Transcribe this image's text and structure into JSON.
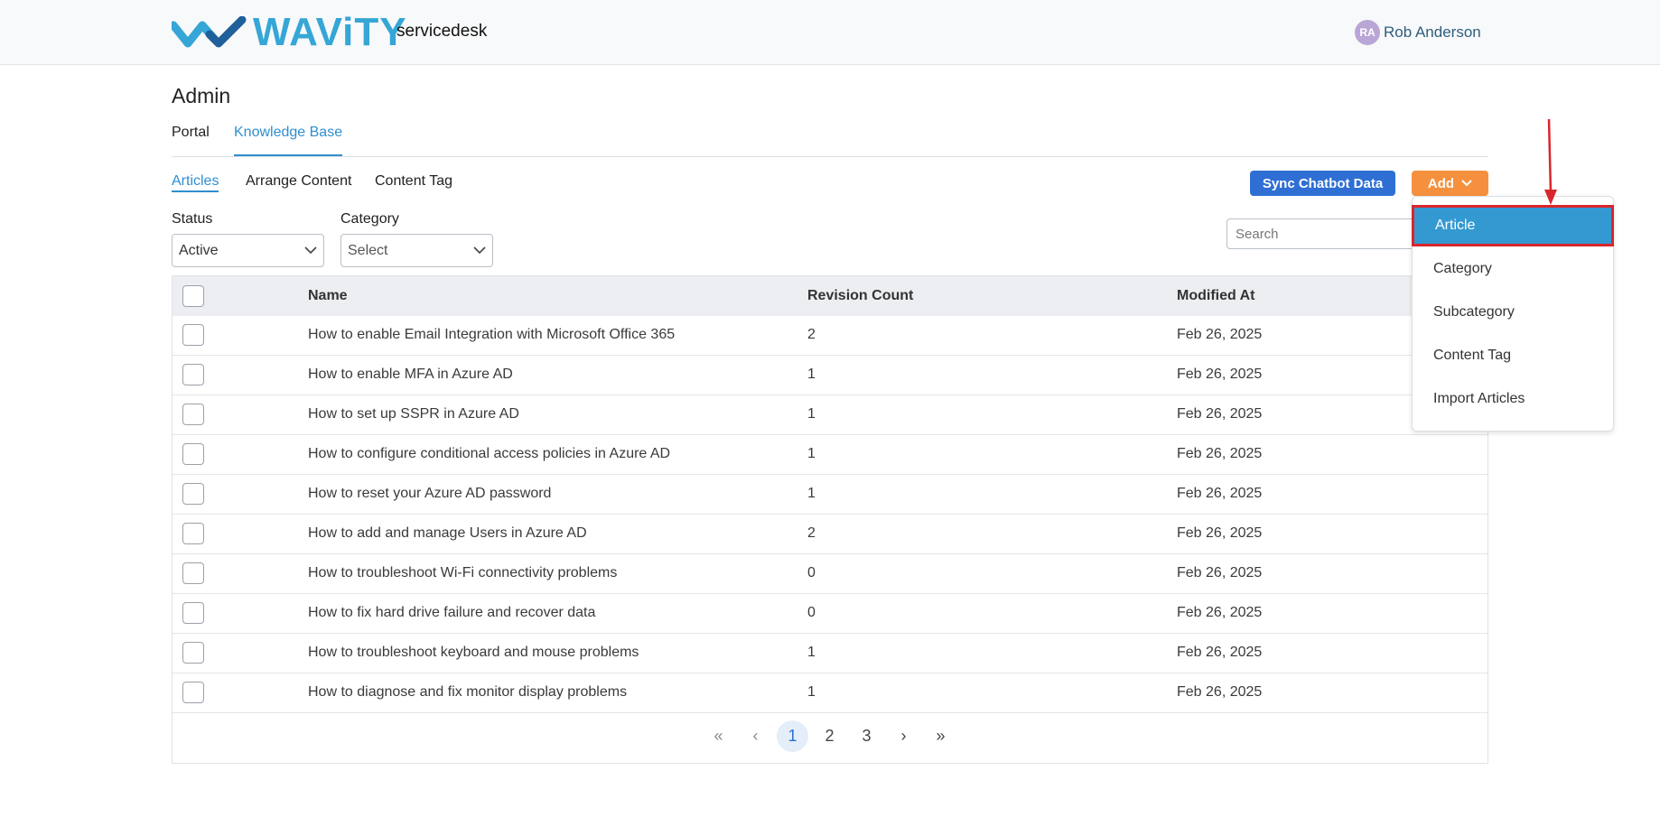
{
  "header": {
    "logo_text": "WAViTY",
    "app_name": "servicedesk",
    "user": {
      "initials": "RA",
      "name": "Rob Anderson"
    }
  },
  "page": {
    "title": "Admin",
    "main_tabs": [
      "Portal",
      "Knowledge Base"
    ],
    "sub_tabs": [
      "Articles",
      "Arrange Content",
      "Content Tag"
    ]
  },
  "toolbar": {
    "sync_label": "Sync Chatbot Data",
    "add_label": "Add"
  },
  "filters": {
    "status_label": "Status",
    "status_value": "Active",
    "category_label": "Category",
    "category_value": "Select",
    "search_placeholder": "Search"
  },
  "table": {
    "columns": [
      "Name",
      "Revision Count",
      "Modified At"
    ],
    "rows": [
      {
        "name": "How to enable Email Integration with Microsoft Office 365",
        "revisions": "2",
        "modified": "Feb 26, 2025"
      },
      {
        "name": "How to enable MFA in Azure AD",
        "revisions": "1",
        "modified": "Feb 26, 2025"
      },
      {
        "name": "How to set up SSPR in Azure AD",
        "revisions": "1",
        "modified": "Feb 26, 2025"
      },
      {
        "name": "How to configure conditional access policies in Azure AD",
        "revisions": "1",
        "modified": "Feb 26, 2025"
      },
      {
        "name": "How to reset your Azure AD password",
        "revisions": "1",
        "modified": "Feb 26, 2025"
      },
      {
        "name": "How to add and manage Users in Azure AD",
        "revisions": "2",
        "modified": "Feb 26, 2025"
      },
      {
        "name": "How to troubleshoot Wi-Fi connectivity problems",
        "revisions": "0",
        "modified": "Feb 26, 2025"
      },
      {
        "name": "How to fix hard drive failure and recover data",
        "revisions": "0",
        "modified": "Feb 26, 2025"
      },
      {
        "name": "How to troubleshoot keyboard and mouse problems",
        "revisions": "1",
        "modified": "Feb 26, 2025"
      },
      {
        "name": "How to diagnose and fix monitor display problems",
        "revisions": "1",
        "modified": "Feb 26, 2025"
      }
    ]
  },
  "pagination": {
    "first": "«",
    "prev": "‹",
    "pages": [
      "1",
      "2",
      "3"
    ],
    "current": "1",
    "next": "›",
    "last": "»"
  },
  "add_menu": {
    "items": [
      "Article",
      "Category",
      "Subcategory",
      "Content Tag",
      "Import Articles"
    ],
    "highlighted": "Article"
  },
  "colors": {
    "brand": "#35a6d6",
    "primary_button": "#2f6fd4",
    "add_button": "#f5913e",
    "highlight": "#3499d1",
    "annotation": "#d9262c"
  }
}
